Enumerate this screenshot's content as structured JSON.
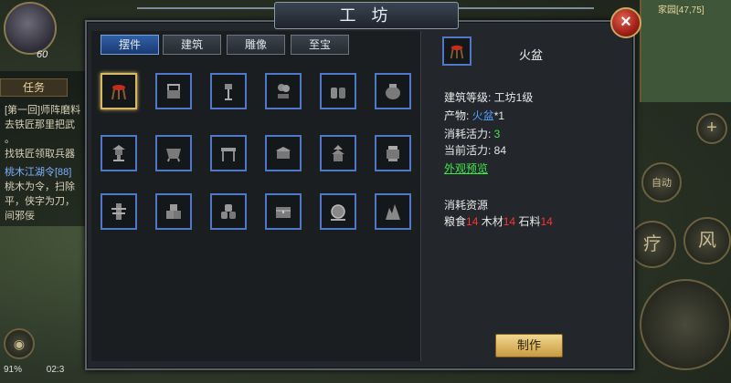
{
  "window": {
    "title": "工 坊",
    "close_symbol": "×"
  },
  "tabs": [
    {
      "label": "摆件",
      "active": true
    },
    {
      "label": "建筑",
      "active": false
    },
    {
      "label": "雕像",
      "active": false
    },
    {
      "label": "至宝",
      "active": false
    }
  ],
  "grid": {
    "rows": [
      [
        "fire-basin-icon",
        "well-icon",
        "lamp-post-icon",
        "bonsai-icon",
        "barrels-icon",
        "jar-icon"
      ],
      [
        "stone-lantern-icon",
        "cauldron-icon",
        "small-table-icon",
        "square-table-icon",
        "pagoda-icon",
        "incense-burner-icon"
      ],
      [
        "training-dummy-icon",
        "crates-icon",
        "stacked-barrels-icon",
        "chest-icon",
        "gong-icon",
        "rockery-icon"
      ]
    ],
    "selected": "fire-basin-icon"
  },
  "detail": {
    "name": "火盆",
    "building_level_label": "建筑等级: 工坊1级",
    "product_label": "产物: ",
    "product_name": "火盆",
    "product_count": "*1",
    "consume_label": "消耗活力: ",
    "consume_value": "3",
    "current_label": "当前活力: ",
    "current_value": "84",
    "preview_link": "外观预览",
    "resources_title": "消耗资源",
    "resources": [
      {
        "name": "粮食",
        "amount": "14"
      },
      {
        "name": "木材",
        "amount": "14"
      },
      {
        "name": "石料",
        "amount": "14"
      }
    ],
    "make_button": "制作"
  },
  "hud": {
    "level": "60",
    "task_tab": "任务",
    "task_lines": [
      "[第一回]师阵磨料",
      "去铁匠那里把武",
      "。",
      "找铁匠领取兵器",
      "桃木江湖令[88]",
      "桃木为令，扫除",
      "平，侠字为刀，",
      "间邪佞"
    ],
    "minimap_label": "家园[47,75]",
    "skill_auto": "自动",
    "skill_1": "疗",
    "skill_2": "风",
    "status_battery": "91%",
    "status_time": "02:3"
  },
  "colors": {
    "slot_border": "#4f78c8",
    "selected_border": "#d8b860",
    "accent_green": "#3ee84a",
    "accent_blue": "#4ea0ff",
    "accent_red": "#ff3030"
  }
}
